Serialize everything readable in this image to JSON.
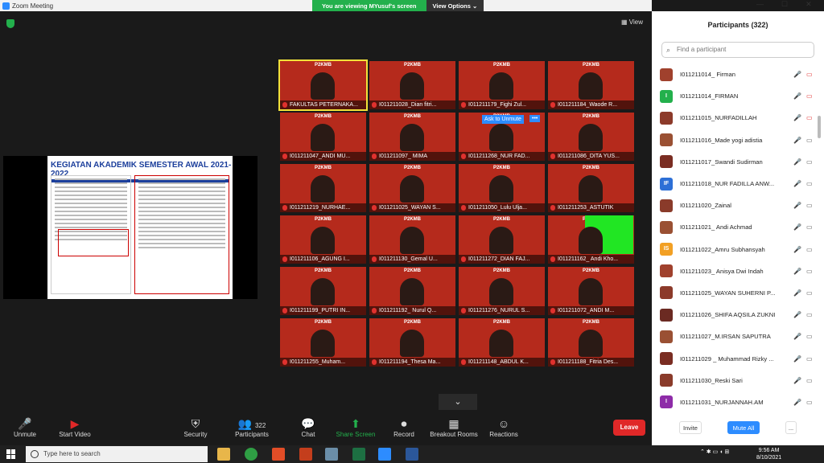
{
  "window": {
    "title": "Zoom Meeting"
  },
  "banner": {
    "viewing": "You are viewing MYusuf's screen",
    "view_options": "View Options ⌄"
  },
  "window_controls": {
    "minimize": "—",
    "maximize": "☐",
    "close": "✕"
  },
  "view_button": "View",
  "shared_slide": {
    "title": "KEGIATAN AKADEMIK SEMESTER AWAL 2021-2022"
  },
  "tiles": [
    {
      "name": "FAKULTAS PETERNAKA...",
      "active": true
    },
    {
      "name": "I011211028_Dian fitri..."
    },
    {
      "name": "I011211179_Fighi Zul..."
    },
    {
      "name": "I011211184_Waode R..."
    },
    {
      "name": "I011211047_ANDI MU..."
    },
    {
      "name": "I011211097_ MIMA"
    },
    {
      "name": "I011211268_NUR FAD...",
      "ask": "Ask to Unmute",
      "dots": "•••"
    },
    {
      "name": "I011211086_DITA YUS..."
    },
    {
      "name": "I011211219_NURHAE..."
    },
    {
      "name": "I011211025_WAYAN S..."
    },
    {
      "name": "I011211050_Lulu Ulja..."
    },
    {
      "name": "I011211253_ASTUTIK"
    },
    {
      "name": "I011211106_AGUNG I..."
    },
    {
      "name": "I011211130_Gemal U..."
    },
    {
      "name": "I011211272_DIAN FAJ..."
    },
    {
      "name": "I011211162_ Andi Kho...",
      "green": true
    },
    {
      "name": "I011211199_PUTRI IN..."
    },
    {
      "name": "I011211192_ Nurul Q..."
    },
    {
      "name": "I011211276_NURUL S..."
    },
    {
      "name": "I011211072_ANDI M..."
    },
    {
      "name": "I011211255_Muham..."
    },
    {
      "name": "I011211194_Thesa Ma..."
    },
    {
      "name": "I011211148_ABDUL K..."
    },
    {
      "name": "I011211188_Fitria Des..."
    }
  ],
  "tile_header": "P2KMB",
  "chevron": "⌄",
  "toolbar": {
    "unmute": "Unmute",
    "start_video": "Start Video",
    "security": "Security",
    "participants": "Participants",
    "participants_count": "322",
    "chat": "Chat",
    "share_screen": "Share Screen",
    "record": "Record",
    "breakout_rooms": "Breakout Rooms",
    "reactions": "Reactions",
    "leave": "Leave"
  },
  "panel": {
    "title": "Participants (322)",
    "search_placeholder": "Find a participant",
    "participants": [
      {
        "name": "I011211014_ Firman",
        "initials": "",
        "color": "#a0412d",
        "video_on": false
      },
      {
        "name": "I011211014_FIRMAN",
        "initials": "I",
        "color": "#23b04c",
        "video_on": false
      },
      {
        "name": "I011211015_NURFADILLAH",
        "initials": "",
        "color": "#8c3a2a",
        "video_on": false
      },
      {
        "name": "I011211016_Made yogi adistia",
        "initials": "",
        "color": "#9a5033",
        "video_on": true
      },
      {
        "name": "I011211017_Swandi Sudirman",
        "initials": "",
        "color": "#7a2d22",
        "video_on": true
      },
      {
        "name": "I011211018_NUR FADILLA ANW...",
        "initials": "IF",
        "color": "#2d6fd6",
        "video_on": true
      },
      {
        "name": "I011211020_Zainal",
        "initials": "",
        "color": "#8a3b2a",
        "video_on": true
      },
      {
        "name": "I011211021_ Andi Achmad",
        "initials": "",
        "color": "#9a5033",
        "video_on": true
      },
      {
        "name": "I011211022_Amru Subhansyah",
        "initials": "IS",
        "color": "#f2a024",
        "video_on": true
      },
      {
        "name": "I011211023_ Anisya Dwi Indah",
        "initials": "",
        "color": "#a0412d",
        "video_on": true
      },
      {
        "name": "I011211025_WAYAN SUHERNI P...",
        "initials": "",
        "color": "#8c3a2a",
        "video_on": true
      },
      {
        "name": "I011211026_SHIFA AQSILA ZUKNI",
        "initials": "",
        "color": "#6b2a22",
        "video_on": true
      },
      {
        "name": "I011211027_M.IRSAN SAPUTRA",
        "initials": "",
        "color": "#9a5033",
        "video_on": true
      },
      {
        "name": "I011211029 _ Muhammad Rizky ...",
        "initials": "",
        "color": "#7a2d22",
        "video_on": true
      },
      {
        "name": "I011211030_Reski Sari",
        "initials": "",
        "color": "#8a3b2a",
        "video_on": true
      },
      {
        "name": "I011211031_NURJANNAH.AM",
        "initials": "I",
        "color": "#8e2ca8",
        "video_on": true
      }
    ],
    "invite": "Invite",
    "mute_all": "Mute All",
    "more": "..."
  },
  "taskbar": {
    "search_placeholder": "Type here to search",
    "time": "9:56 AM",
    "date": "8/10/2021"
  }
}
